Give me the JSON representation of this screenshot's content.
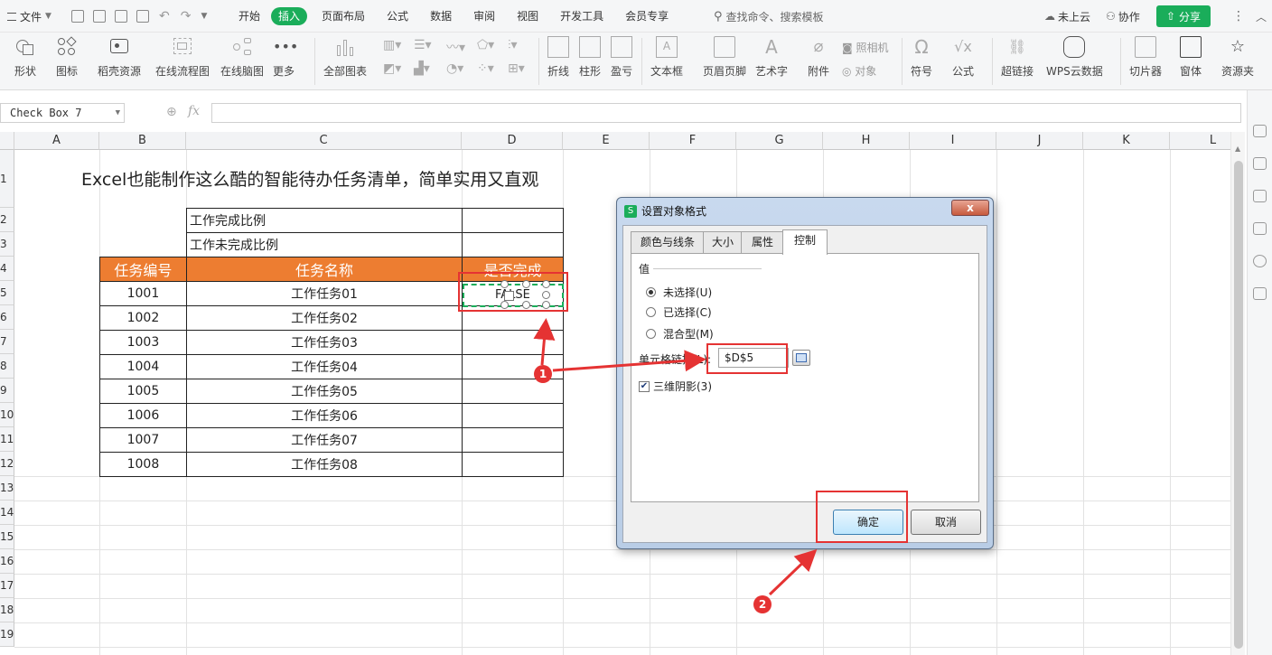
{
  "menubar": {
    "file_label": "文件",
    "tabs": [
      "开始",
      "插入",
      "页面布局",
      "公式",
      "数据",
      "审阅",
      "视图",
      "开发工具",
      "会员专享"
    ],
    "active_tab": "插入",
    "search_text": "查找命令、搜索模板",
    "cloud_status": "未上云",
    "collab_label": "协作",
    "share_label": "分享"
  },
  "ribbon": {
    "buttons": [
      "形状",
      "图标",
      "稻壳资源",
      "在线流程图",
      "在线脑图",
      "更多",
      "全部图表",
      "折线",
      "柱形",
      "盈亏",
      "文本框",
      "页眉页脚",
      "艺术字",
      "附件",
      "符号",
      "公式",
      "超链接",
      "WPS云数据",
      "切片器",
      "窗体",
      "资源夹"
    ],
    "camera_label": "照相机",
    "object_label": "对象"
  },
  "formula_bar": {
    "name_box": "Check Box 7",
    "fx_label": "fx"
  },
  "grid": {
    "columns": [
      "A",
      "B",
      "C",
      "D",
      "E",
      "F",
      "G",
      "H",
      "I",
      "J",
      "K",
      "L"
    ],
    "rows": [
      "1",
      "2",
      "3",
      "4",
      "5",
      "6",
      "7",
      "8",
      "9",
      "10",
      "11",
      "12",
      "13",
      "14",
      "15",
      "16",
      "17",
      "18",
      "19"
    ],
    "title": "Excel也能制作这么酷的智能待办任务清单，简单实用又直观",
    "summary": [
      "工作完成比例",
      "工作未完成比例"
    ],
    "headers": [
      "任务编号",
      "任务名称",
      "是否完成"
    ],
    "tasks": [
      {
        "id": "1001",
        "name": "工作任务01"
      },
      {
        "id": "1002",
        "name": "工作任务02"
      },
      {
        "id": "1003",
        "name": "工作任务03"
      },
      {
        "id": "1004",
        "name": "工作任务04"
      },
      {
        "id": "1005",
        "name": "工作任务05"
      },
      {
        "id": "1006",
        "name": "工作任务06"
      },
      {
        "id": "1007",
        "name": "工作任务07"
      },
      {
        "id": "1008",
        "name": "工作任务08"
      }
    ],
    "checkbox_text": "FALSE"
  },
  "dialog": {
    "title": "设置对象格式",
    "app_icon": "S",
    "close_label": "x",
    "tabs": [
      "颜色与线条",
      "大小",
      "属性",
      "控制"
    ],
    "active_tab": "控制",
    "value_group": "值",
    "options": [
      "未选择(U)",
      "已选择(C)",
      "混合型(M)"
    ],
    "selected_option": "未选择(U)",
    "cell_link_label": "单元格链接(L):",
    "cell_link_value": "$D$5",
    "shadow_label": "三维阴影(3)",
    "shadow_checked": true,
    "ok_label": "确定",
    "cancel_label": "取消"
  },
  "annotations": {
    "badge_1": "1",
    "badge_2": "2",
    "color": "#e53333"
  },
  "colors": {
    "accent_green": "#1aad5a",
    "header_orange": "#ed7d31"
  }
}
